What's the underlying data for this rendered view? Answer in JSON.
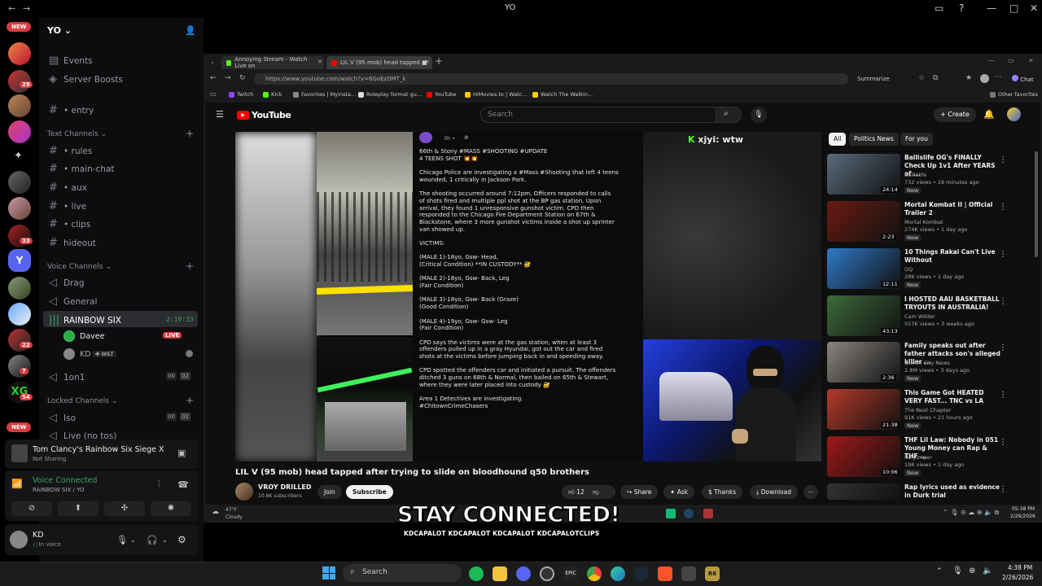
{
  "window": {
    "title": "YO"
  },
  "server": {
    "name": "YO"
  },
  "rail": {
    "new_top": "NEW",
    "new_bottom": "NEW",
    "badges": [
      "29",
      "33",
      "22",
      "7",
      "54"
    ]
  },
  "channels": {
    "entry": "• entry",
    "events": "Events",
    "boosts": "Server Boosts",
    "text_cat": "Text Channels",
    "text": [
      "• rules",
      "• main-chat",
      "• aux",
      "• live",
      "• clips",
      "hideout"
    ],
    "voice_cat": "Voice Channels",
    "voice": [
      "Drag",
      "General",
      "RAINBOW SIX"
    ],
    "vc_timer": "2:19:33",
    "members": [
      {
        "name": "Davee",
        "tag": "LIVE"
      },
      {
        "name": "KD",
        "tag": "WILT"
      }
    ],
    "one_on_one": "1on1",
    "one_count": [
      "00",
      "02"
    ],
    "locked_cat": "Locked Channels",
    "iso": "Iso",
    "iso_count": [
      "00",
      "02"
    ],
    "live_no_tos": "Live (no tos)"
  },
  "activity": {
    "game": "Tom Clancy's Rainbow Six Siege X",
    "status": "Not Sharing"
  },
  "voice": {
    "status": "Voice Connected",
    "location": "RAINBOW SIX / YO"
  },
  "user": {
    "name": "KD",
    "status": "In voice"
  },
  "browser": {
    "tabs": [
      "Annoying Stream - Watch Live on",
      "LIL V (95 mob) head tapped ■"
    ],
    "url": "https://www.youtube.com/watch?v=6GoEzDMT_k",
    "summarize": "Summarize",
    "chat": "Chat",
    "favorites": [
      "Twitch",
      "Kick",
      "Favorites | Myinsta...",
      "Roleplay format gu...",
      "YouTube",
      "HiMovies.to | Watc...",
      "Watch The Walkin..."
    ],
    "other_favs": "Other favorites"
  },
  "youtube": {
    "logo": "YouTube",
    "search_placeholder": "Search",
    "create": "+ Create",
    "chips": [
      "All",
      "Politics News",
      "For you"
    ],
    "video_title": "LIL V (95 mob) head tapped after trying to slide on bloodhound q50 brothers",
    "channel": "VROY DRILLED",
    "subs": "10.8K subscribers",
    "join": "Join",
    "subscribe": "Subscribe",
    "likes": "12",
    "share": "Share",
    "ask": "Ask",
    "thanks": "Thanks",
    "download": "Download",
    "post_time": "3h •",
    "post_lines": [
      "66th & Stony #MASS #SHOOTING #UPDATE",
      "4 TEENS SHOT 💥💥",
      "",
      "Chicago Police are investigating a #Mass #Shooting that left 4 teens",
      "wounded, 1 critically in Jackson Park.",
      "",
      "The shooting occurred around 7:12pm, Officers responded to calls",
      "of shots fired and multiple ppl shot at the BP gas station. Upon",
      "arrival, they found 1 unresponsive gunshot victim. CPD then",
      "responded to the Chicago Fire Department Station on 67th &",
      "Blackstone, where 3 more gunshot victims inside a shot up sprinter",
      "van showed up.",
      "",
      "VICTIMS:",
      "",
      "(MALE 1)-18yo, Gsw- Head,",
      "(Critical Condition) **IN CUSTODY** 🔐",
      "",
      "(MALE 2)-18yo, Gsw- Back, Leg",
      "(Fair Condition)",
      "",
      "(MALE 3)-18yo, Gsw- Back (Graze)",
      "(Good Condition)",
      "",
      "(MALE 4)-19yo, Gsw- Gsw- Leg",
      "(Fair Condition)",
      "",
      "CPD says the victims were at the gas station, when at least 3",
      "offenders pulled up in a gray Hyundai, got out the car and fired",
      "shots at the victims before jumping back in and speeding away.",
      "",
      "CPD spotted the offenders car and initiated a pursuit. The offenders",
      "ditched 3 guns on 68th & Normal, then bailed on 65th & Stewart,",
      "where they were later placed into custody 🔐",
      "",
      "Area 1 Detectives are investigating.",
      "#ChitownCrimeChasers"
    ],
    "kick_chat": "xjyi: wtw",
    "recs": [
      {
        "title": "Ballislife OG's FINALLY Check Up 1v1 After YEARS of ...",
        "channel": "Ballislife",
        "meta": "732 views • 19 minutes ago",
        "tag": "New",
        "dur": "24:14",
        "color": "#5a6b7c"
      },
      {
        "title": "Mortal Kombat II | Official Trailer 2",
        "channel": "Mortal Kombat",
        "meta": "274K views • 1 day ago",
        "tag": "New",
        "dur": "2:23",
        "color": "#6b1a12"
      },
      {
        "title": "10 Things Rakai Can't Live Without",
        "channel": "GQ",
        "meta": "28K views • 1 day ago",
        "tag": "New",
        "dur": "12:11",
        "color": "#2f7ac9"
      },
      {
        "title": "I HOSTED AAU BASKETBALL TRYOUTS IN AUSTRALIA!",
        "channel": "Cam Wilder",
        "meta": "557K views • 3 weeks ago",
        "tag": "",
        "dur": "43:13",
        "color": "#3d6b3a"
      },
      {
        "title": "Family speaks out after father attacks son's alleged killer ...",
        "channel": "Queen City News",
        "meta": "2.8M views • 3 days ago",
        "tag": "New",
        "dur": "2:36",
        "color": "#8a8580"
      },
      {
        "title": "This Game Got HEATED VERY FAST... TNC vs LA",
        "channel": "The Next Chapter",
        "meta": "91K views • 21 hours ago",
        "tag": "New",
        "dur": "21:38",
        "color": "#b53a2a"
      },
      {
        "title": "THF Lil Law: Nobody in 051 Young Money can Rap & THF ...",
        "channel": "No Jumper",
        "meta": "19K views • 1 day ago",
        "tag": "New",
        "dur": "10:06",
        "color": "#a01818"
      },
      {
        "title": "Rap lyrics used as evidence in Durk trial",
        "channel": "",
        "meta": "",
        "tag": "",
        "dur": "",
        "color": "#333"
      }
    ]
  },
  "weather": {
    "temp": "47°F",
    "cond": "Cloudy"
  },
  "overlay": {
    "headline": "STAY CONNECTED!",
    "socials": "KDCAPALOT   KDCAPALOT   KDCAPALOT   KDCAPALOTCLIPS"
  },
  "inner_clock": {
    "time": "05:38 PM",
    "date": "2/26/2026"
  },
  "taskbar": {
    "search": "Search",
    "time": "4:38 PM",
    "date": "2/26/2026"
  }
}
